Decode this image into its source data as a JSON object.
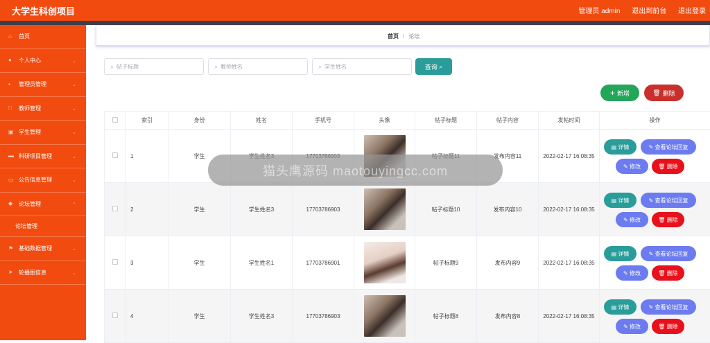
{
  "header": {
    "title": "大学生科创项目",
    "user_label": "管理员 admin",
    "front_link": "退出到前台",
    "logout_link": "退出登录"
  },
  "sidebar": {
    "items": [
      {
        "label": "首页",
        "icon": "home-icon"
      },
      {
        "label": "个人中心",
        "icon": "user-icon",
        "chevron": "⌄"
      },
      {
        "label": "管理员管理",
        "icon": "admin-icon",
        "chevron": "⌄"
      },
      {
        "label": "教师管理",
        "icon": "teacher-icon",
        "chevron": "⌄"
      },
      {
        "label": "学生管理",
        "icon": "student-icon",
        "chevron": "⌄"
      },
      {
        "label": "科研项目管理",
        "icon": "project-icon",
        "chevron": "⌄"
      },
      {
        "label": "公告信息管理",
        "icon": "notice-icon",
        "chevron": "⌄"
      },
      {
        "label": "论坛管理",
        "icon": "forum-icon",
        "chevron": "⌃"
      },
      {
        "label": "论坛管理",
        "icon": "",
        "sub": true
      },
      {
        "label": "基础数据管理",
        "icon": "flag-icon",
        "chevron": "⌄"
      },
      {
        "label": "轮播图信息",
        "icon": "send-icon",
        "chevron": "⌄"
      }
    ]
  },
  "breadcrumb": {
    "home": "首页",
    "sep": "/",
    "current": "论坛"
  },
  "search": {
    "title_placeholder": "帖子标题",
    "teacher_placeholder": "教师姓名",
    "student_placeholder": "学生姓名",
    "query_label": "查询"
  },
  "actions": {
    "add_label": "新增",
    "delete_label": "删除"
  },
  "table": {
    "headers": [
      "",
      "索引",
      "身份",
      "姓名",
      "手机号",
      "头像",
      "帖子标题",
      "帖子内容",
      "发帖时间",
      "操作"
    ],
    "rows": [
      {
        "index": "1",
        "role": "学生",
        "name": "学生姓名3",
        "phone": "17703786903",
        "title": "帖子标题11",
        "content": "发布内容11",
        "time": "2022-02-17 16:08:35"
      },
      {
        "index": "2",
        "role": "学生",
        "name": "学生姓名3",
        "phone": "17703786903",
        "title": "帖子标题10",
        "content": "发布内容10",
        "time": "2022-02-17 16:08:35"
      },
      {
        "index": "3",
        "role": "学生",
        "name": "学生姓名1",
        "phone": "17703786901",
        "title": "帖子标题9",
        "content": "发布内容9",
        "time": "2022-02-17 16:08:35"
      },
      {
        "index": "4",
        "role": "学生",
        "name": "学生姓名3",
        "phone": "17703786903",
        "title": "帖子标题8",
        "content": "发布内容8",
        "time": "2022-02-17 16:08:35"
      }
    ],
    "ops": {
      "detail": "详情",
      "view": "查看论坛回复",
      "edit": "修改",
      "delete": "删除"
    }
  },
  "overlay_text": "猫头鹰源码 maotouyingcc.com",
  "colors": {
    "brand": "#f24b10",
    "teal": "#2a9c9a",
    "green": "#23a55a",
    "red": "#c9302c",
    "purple": "#6c7cf0",
    "danger": "#e8101b"
  }
}
